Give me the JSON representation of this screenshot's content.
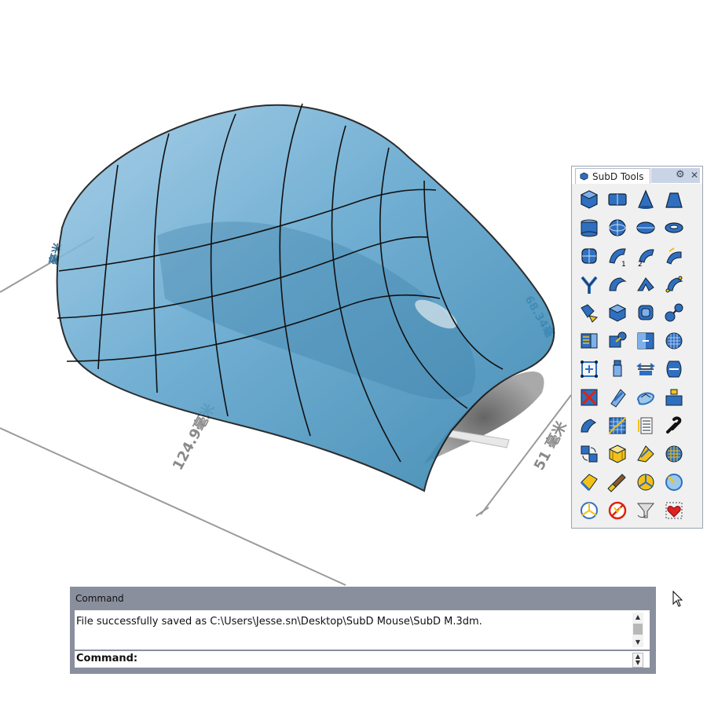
{
  "viewport": {
    "dimension_label_length": "124.9毫米",
    "dimension_label_height": "51 毫米",
    "dimension_label_width": "68.34毫",
    "dimension_label_side": "毫米"
  },
  "subd_panel": {
    "title": "SubD Tools",
    "icons": [
      "subd-box-icon",
      "subd-plane-icon",
      "subd-cone-icon",
      "subd-truncated-cone-icon",
      "subd-cylinder-icon",
      "subd-sphere-icon",
      "subd-ellipsoid-icon",
      "subd-torus-icon",
      "subd-quadball-icon",
      "subd-loft-1-icon",
      "subd-loft-2-icon",
      "subd-sweep-icon",
      "subd-skin-icon",
      "subd-revolve-icon",
      "subd-rail-icon",
      "subd-control-polygon-icon",
      "subd-bevel-icon",
      "subd-extrude-icon",
      "subd-offset-icon",
      "subd-stitch-icon",
      "subd-bridge-icon",
      "subd-fill-icon",
      "subd-merge-icon",
      "subd-refine-icon",
      "subd-gumball-icon",
      "subd-insert-edge-icon",
      "subd-slide-icon",
      "subd-weld-icon",
      "subd-delete-icon",
      "subd-crease-icon",
      "subd-smooth-icon",
      "subd-select-icon",
      "subd-patch-icon",
      "subd-grid-icon",
      "subd-list-icon",
      "subd-repair-icon",
      "subd-convert-icon",
      "subd-box-mode-icon",
      "subd-shell-icon",
      "subd-rebuild-icon",
      "subd-paint-icon",
      "subd-brush-icon",
      "subd-triangle-icon",
      "subd-sphere-select-icon",
      "subd-corner-icon",
      "subd-no-icon",
      "subd-funnel-icon",
      "subd-heart-icon"
    ]
  },
  "command": {
    "title": "Command",
    "history": "File successfully saved as C:\\Users\\Jesse.sn\\Desktop\\SubD Mouse\\SubD M.3dm.",
    "prompt_label": "Command:",
    "prompt_value": ""
  },
  "colors": {
    "shell": "#5fa6cf",
    "shell_dark": "#1f6f98",
    "panel_bg": "#f0f0f0",
    "icon_blue": "#2f6fc0",
    "icon_yellow": "#f2c21a",
    "command_frame": "#8a8f9e"
  }
}
